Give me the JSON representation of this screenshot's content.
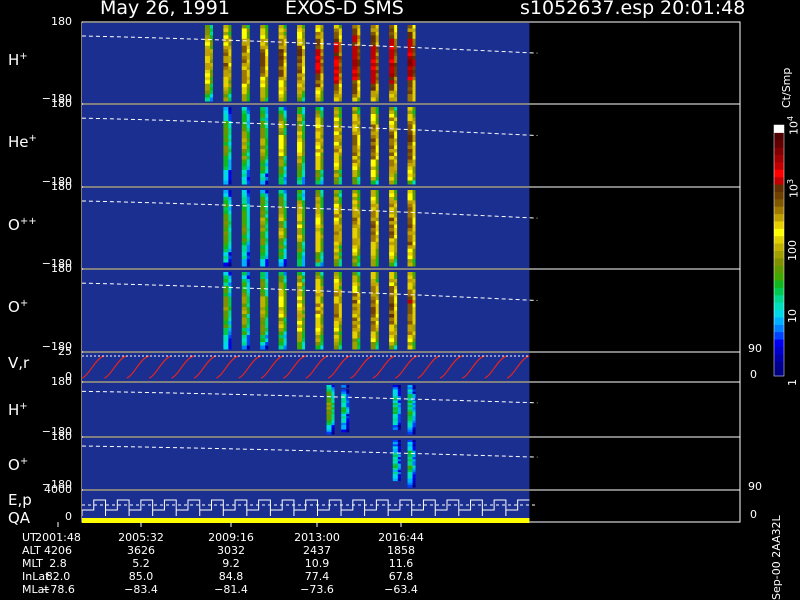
{
  "header": {
    "date": "May 26, 1991",
    "mission": "EXOS-D SMS",
    "file": "s1052637.esp",
    "time": "20:01:48"
  },
  "colors": {
    "background": "#000000",
    "panel_background": "#1a2f8f",
    "trace": "#ffffff",
    "velocity_trace": "#e8241c",
    "qa_bar": "#ffff00"
  },
  "panels": [
    {
      "key": "h",
      "label": "H",
      "sup": "+",
      "ymax": "180",
      "ymin": "−180"
    },
    {
      "key": "he",
      "label": "He",
      "sup": "+",
      "ymax": "180",
      "ymin": "−180"
    },
    {
      "key": "opp",
      "label": "O",
      "sup": "++",
      "ymax": "180",
      "ymin": "−180"
    },
    {
      "key": "op",
      "label": "O",
      "sup": "+",
      "ymax": "180",
      "ymin": "−180"
    },
    {
      "key": "vr",
      "label": "V,r",
      "sup": "",
      "ymax": "25",
      "ymin": "0",
      "rmax": "90",
      "rmin": "0"
    },
    {
      "key": "h2",
      "label": "H",
      "sup": "+",
      "ymax": "180",
      "ymin": "−180"
    },
    {
      "key": "o2",
      "label": "O",
      "sup": "+",
      "ymax": "180",
      "ymin": "−180"
    },
    {
      "key": "ep",
      "label": "E,p",
      "label2": "QA",
      "sup": "",
      "ymax": "4000",
      "ymin": "0",
      "rmax": "90",
      "rmin": "0"
    }
  ],
  "colorbar": {
    "unit": "Ct/Smp",
    "ticks": [
      {
        "label": "1",
        "frac": 0.0
      },
      {
        "label": "10",
        "frac": 0.25
      },
      {
        "label": "100",
        "frac": 0.5
      },
      {
        "label": "10",
        "sup": "3",
        "frac": 0.75
      },
      {
        "label": "10",
        "sup": "4",
        "frac": 1.0
      }
    ],
    "colors": [
      "#000080",
      "#00008c",
      "#0000aa",
      "#0000cc",
      "#0000ee",
      "#0040ff",
      "#0080ff",
      "#00b0ff",
      "#00d8e8",
      "#00e0c0",
      "#00d890",
      "#00c850",
      "#10b820",
      "#40a800",
      "#609800",
      "#809000",
      "#a0a000",
      "#c0b000",
      "#e0d000",
      "#ffff00",
      "#e8d000",
      "#c0a000",
      "#a07800",
      "#805800",
      "#704000",
      "#603000",
      "#c00000",
      "#ff0000",
      "#c00000",
      "#a00000",
      "#800000",
      "#600000",
      "#500000",
      "#ffffff"
    ]
  },
  "footer": {
    "row_labels": [
      "UT",
      "ALT",
      "MLT",
      "InLat",
      "MLat"
    ],
    "columns": [
      {
        "UT": "2001:48",
        "ALT": "4206",
        "MLT": "2.8",
        "InLat": "82.0",
        "MLat": "−78.6"
      },
      {
        "UT": "2005:32",
        "ALT": "3626",
        "MLT": "5.2",
        "InLat": "85.0",
        "MLat": "−83.4"
      },
      {
        "UT": "2009:16",
        "ALT": "3032",
        "MLT": "9.2",
        "InLat": "84.8",
        "MLat": "−81.4"
      },
      {
        "UT": "2013:00",
        "ALT": "2437",
        "MLT": "10.9",
        "InLat": "77.4",
        "MLat": "−73.6"
      },
      {
        "UT": "2016:44",
        "ALT": "1858",
        "MLT": "11.6",
        "InLat": "67.8",
        "MLat": "−63.4"
      }
    ],
    "stamp": "Sep-00  2AA32L"
  },
  "chart_data": {
    "type": "heatmap",
    "title": "May 26, 1991   EXOS-D SMS",
    "xlabel": "UT",
    "x_ticks": [
      "2001:48",
      "2005:32",
      "2009:16",
      "2013:00",
      "2016:44"
    ],
    "y_range": [
      -180,
      180
    ],
    "z_unit": "Ct/Smp",
    "z_scale": "log",
    "z_range": [
      1,
      10000
    ],
    "data_end_fraction": 0.68,
    "series": [
      {
        "name": "H+",
        "bursts": [
          {
            "t": "2007:30",
            "peak": 300
          },
          {
            "t": "2008:20",
            "peak": 500
          },
          {
            "t": "2009:10",
            "peak": 600
          },
          {
            "t": "2010:00",
            "peak": 600
          },
          {
            "t": "2010:50",
            "peak": 800
          },
          {
            "t": "2011:40",
            "peak": 900
          },
          {
            "t": "2012:30",
            "peak": 1500
          },
          {
            "t": "2013:20",
            "peak": 1800
          },
          {
            "t": "2014:10",
            "peak": 2500
          },
          {
            "t": "2015:00",
            "peak": 2500
          },
          {
            "t": "2015:50",
            "peak": 3000
          },
          {
            "t": "2016:40",
            "peak": 3000
          }
        ]
      },
      {
        "name": "He+",
        "bursts": [
          {
            "t": "2008:20",
            "peak": 50
          },
          {
            "t": "2009:10",
            "peak": 80
          },
          {
            "t": "2010:00",
            "peak": 100
          },
          {
            "t": "2010:50",
            "peak": 150
          },
          {
            "t": "2011:40",
            "peak": 200
          },
          {
            "t": "2012:30",
            "peak": 300
          },
          {
            "t": "2013:20",
            "peak": 400
          },
          {
            "t": "2014:10",
            "peak": 500
          },
          {
            "t": "2015:00",
            "peak": 600
          },
          {
            "t": "2015:50",
            "peak": 700
          },
          {
            "t": "2016:40",
            "peak": 800
          }
        ]
      },
      {
        "name": "O++",
        "bursts": [
          {
            "t": "2008:20",
            "peak": 50
          },
          {
            "t": "2009:10",
            "peak": 60
          },
          {
            "t": "2010:00",
            "peak": 80
          },
          {
            "t": "2010:50",
            "peak": 100
          },
          {
            "t": "2011:40",
            "peak": 150
          },
          {
            "t": "2012:30",
            "peak": 250
          },
          {
            "t": "2013:20",
            "peak": 350
          },
          {
            "t": "2014:10",
            "peak": 450
          },
          {
            "t": "2015:00",
            "peak": 550
          },
          {
            "t": "2015:50",
            "peak": 650
          },
          {
            "t": "2016:40",
            "peak": 800
          }
        ]
      },
      {
        "name": "O+",
        "bursts": [
          {
            "t": "2008:20",
            "peak": 60
          },
          {
            "t": "2009:10",
            "peak": 80
          },
          {
            "t": "2010:00",
            "peak": 100
          },
          {
            "t": "2010:50",
            "peak": 150
          },
          {
            "t": "2011:40",
            "peak": 250
          },
          {
            "t": "2012:30",
            "peak": 350
          },
          {
            "t": "2013:20",
            "peak": 450
          },
          {
            "t": "2014:10",
            "peak": 550
          },
          {
            "t": "2015:00",
            "peak": 650
          },
          {
            "t": "2015:50",
            "peak": 750
          },
          {
            "t": "2016:40",
            "peak": 900
          }
        ]
      },
      {
        "name": "H+ (2)",
        "bursts": [
          {
            "t": "2013:00",
            "peak": 60
          },
          {
            "t": "2013:40",
            "peak": 20
          },
          {
            "t": "2016:00",
            "peak": 20
          },
          {
            "t": "2016:40",
            "peak": 30
          }
        ]
      },
      {
        "name": "O+ (2)",
        "bursts": [
          {
            "t": "2016:00",
            "peak": 20
          },
          {
            "t": "2016:40",
            "peak": 30
          }
        ]
      }
    ],
    "velocity_panel": {
      "ylim_left": [
        0,
        25
      ],
      "ylim_right": [
        0,
        90
      ],
      "pattern": "sawtooth",
      "cycles": 20
    },
    "energy_panel": {
      "ylim_left": [
        0,
        4000
      ],
      "ylim_right": [
        0,
        90
      ],
      "pattern": "staircase",
      "cycles": 19
    }
  }
}
